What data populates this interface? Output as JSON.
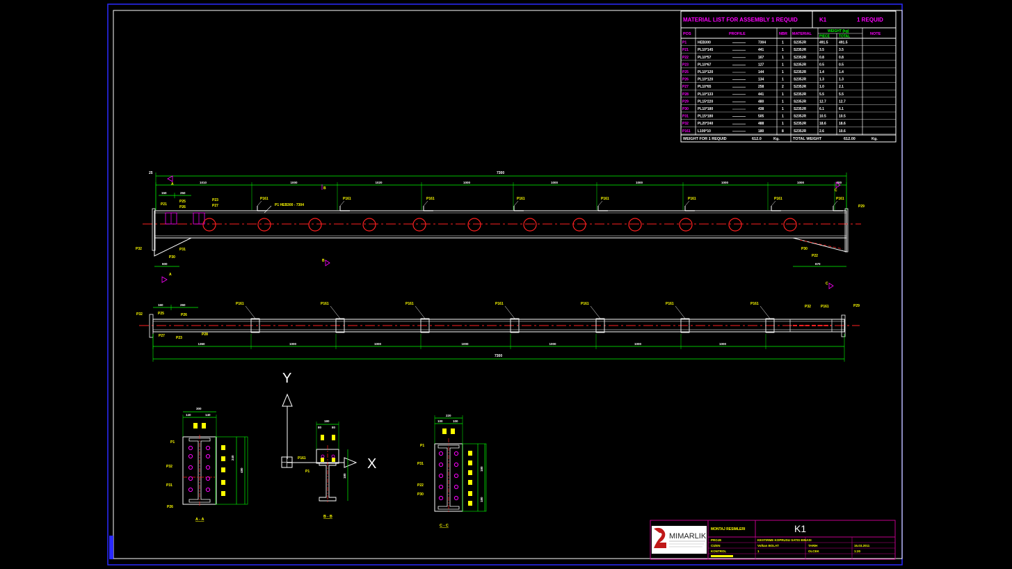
{
  "material_list": {
    "title": "MATERIAL LIST FOR ASSEMBLY 1 REQUID",
    "assembly_mark": "K1",
    "required": "1 REQUID",
    "headers": {
      "pos": "POS",
      "profile": "PROFILE",
      "number": "NBR",
      "material": "MATERIAL",
      "weight": "WEIGHT (kg)",
      "piece": "PIECE",
      "total": "TOTAL",
      "note": "NOTE"
    },
    "rows": [
      {
        "pos": "P1",
        "profile": "HEB300",
        "length": "7304",
        "nbr": "1",
        "material": "S235JR",
        "piece": "491.5",
        "total": "491.5"
      },
      {
        "pos": "P21",
        "profile": "PL10*145",
        "length": "441",
        "nbr": "1",
        "material": "S235JR",
        "piece": "3.5",
        "total": "3.5"
      },
      {
        "pos": "P22",
        "profile": "PL10*57",
        "length": "167",
        "nbr": "1",
        "material": "S235JR",
        "piece": "0.8",
        "total": "0.8"
      },
      {
        "pos": "P23",
        "profile": "PL10*67",
        "length": "127",
        "nbr": "1",
        "material": "S235JR",
        "piece": "0.5",
        "total": "0.5"
      },
      {
        "pos": "P25",
        "profile": "PL10*120",
        "length": "144",
        "nbr": "1",
        "material": "S235JR",
        "piece": "1.4",
        "total": "1.4"
      },
      {
        "pos": "P26",
        "profile": "PL10*120",
        "length": "134",
        "nbr": "1",
        "material": "S235JR",
        "piece": "1.3",
        "total": "1.3"
      },
      {
        "pos": "P27",
        "profile": "PL10*65",
        "length": "258",
        "nbr": "2",
        "material": "S235JR",
        "piece": "1.0",
        "total": "2.1"
      },
      {
        "pos": "P28",
        "profile": "PL10*133",
        "length": "441",
        "nbr": "1",
        "material": "S235JR",
        "piece": "5.5",
        "total": "5.5"
      },
      {
        "pos": "P29",
        "profile": "PL15*220",
        "length": "480",
        "nbr": "1",
        "material": "S235JR",
        "piece": "12.7",
        "total": "12.7"
      },
      {
        "pos": "P30",
        "profile": "PL10*180",
        "length": "438",
        "nbr": "1",
        "material": "S235JR",
        "piece": "6.1",
        "total": "6.1"
      },
      {
        "pos": "P31",
        "profile": "PL15*180",
        "length": "505",
        "nbr": "1",
        "material": "S235JR",
        "piece": "10.5",
        "total": "10.5"
      },
      {
        "pos": "P32",
        "profile": "PL20*240",
        "length": "488",
        "nbr": "1",
        "material": "S235JR",
        "piece": "18.6",
        "total": "18.6"
      },
      {
        "pos": "P161",
        "profile": "L100*10",
        "length": "180",
        "nbr": "8",
        "material": "S235JR",
        "piece": "2.6",
        "total": "10.6"
      }
    ],
    "footer": {
      "weight_label": "WEIGHT FOR 1 REQUID",
      "weight_value": "612.0",
      "weight_unit": "Kg.",
      "total_label": "TOTAL WEIGHT",
      "total_value": "612.00",
      "total_unit": "Kg."
    }
  },
  "elevation": {
    "total_dim": "7300",
    "end_dim": "25",
    "segment_dims": [
      "1010",
      "1000",
      "1020",
      "1000",
      "1000",
      "1000",
      "1000",
      "1000",
      "300",
      "200"
    ],
    "small_dims": [
      "150",
      "250"
    ],
    "bottom_left_dim": "600",
    "bottom_right_dim": "670",
    "labels": {
      "p21": "P21",
      "p27": "P27",
      "p28": "P28",
      "p25": "P25",
      "p23": "P23",
      "p26": "P26",
      "p32": "P32",
      "p31": "P31",
      "p30": "P30",
      "p22": "P22",
      "p29": "P29",
      "p161": "P161",
      "p1_callout": "P1 HEB300 - 7304"
    },
    "section_marks": {
      "a": "A",
      "b": "B",
      "c": "C"
    }
  },
  "plan": {
    "total_dim": "7300",
    "segment_dims": [
      "1360",
      "1000",
      "1000",
      "1000",
      "1000",
      "1000",
      "1000"
    ],
    "small_dims": [
      "160",
      "260"
    ],
    "labels": {
      "p161": "P161",
      "p32": "P32",
      "p25": "P25",
      "p26": "P26",
      "p27": "P27",
      "p23": "P23",
      "p28": "P28",
      "p29": "P29"
    }
  },
  "axis": {
    "y": "Y",
    "x": "X"
  },
  "sections": [
    {
      "title": "A - A",
      "labels": [
        "P1",
        "P32",
        "P31",
        "P26"
      ],
      "top_dim": "300",
      "sub_dims": [
        "140",
        "140"
      ],
      "side_dims": [
        "240",
        "480"
      ]
    },
    {
      "title": "B - B",
      "labels": [
        "P161",
        "P1"
      ],
      "top_dim": "180",
      "sub_dims": [
        "80",
        "80"
      ],
      "side_dims": [
        "180"
      ]
    },
    {
      "title": "C - C",
      "labels": [
        "P1",
        "P31",
        "P22",
        "P30"
      ],
      "top_dim": "220",
      "sub_dims": [
        "100",
        "100"
      ],
      "side_dims": [
        "180",
        "180"
      ]
    }
  ],
  "title_block": {
    "logo_name": "MIMARLIK",
    "heading": "MONTAJ RESIMLERI",
    "drawing_mark": "K1",
    "rows": [
      {
        "label": "PROJE",
        "value": "KESTIRME KOPRUSU SATIS BINASI"
      },
      {
        "label": "CIZEN",
        "value": "Volkan BOLAT"
      },
      {
        "label": "KONTROL",
        "value": "1"
      }
    ],
    "right": [
      {
        "label": "TARIH",
        "value": "15.03.2011"
      },
      {
        "label": "OLCEK",
        "value": "1:20"
      }
    ]
  },
  "colors": {
    "background": "#000000",
    "frame": "#2020ff",
    "border_white": "#ffffff",
    "dimension": "#00ff00",
    "label": "#ffff00",
    "table_title": "#ff00ff",
    "centerline": "#ff2020",
    "hole": "#ff2020",
    "steel": "#ffffff",
    "title_block": "#b0007a"
  }
}
